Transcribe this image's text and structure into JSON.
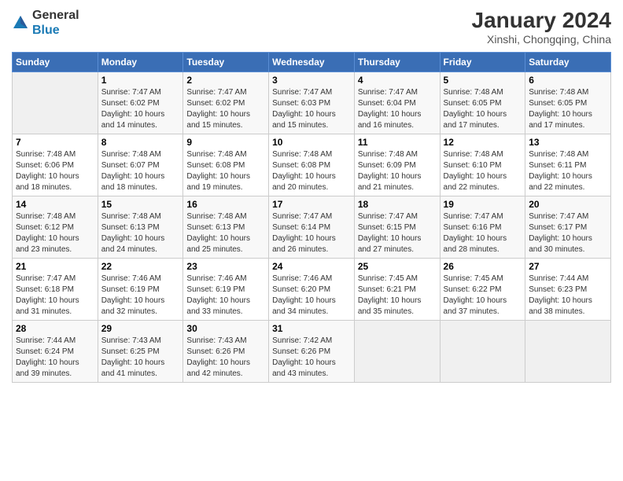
{
  "logo": {
    "general": "General",
    "blue": "Blue"
  },
  "title": "January 2024",
  "subtitle": "Xinshi, Chongqing, China",
  "days_of_week": [
    "Sunday",
    "Monday",
    "Tuesday",
    "Wednesday",
    "Thursday",
    "Friday",
    "Saturday"
  ],
  "weeks": [
    [
      {
        "day": "",
        "info": ""
      },
      {
        "day": "1",
        "info": "Sunrise: 7:47 AM\nSunset: 6:02 PM\nDaylight: 10 hours\nand 14 minutes."
      },
      {
        "day": "2",
        "info": "Sunrise: 7:47 AM\nSunset: 6:02 PM\nDaylight: 10 hours\nand 15 minutes."
      },
      {
        "day": "3",
        "info": "Sunrise: 7:47 AM\nSunset: 6:03 PM\nDaylight: 10 hours\nand 15 minutes."
      },
      {
        "day": "4",
        "info": "Sunrise: 7:47 AM\nSunset: 6:04 PM\nDaylight: 10 hours\nand 16 minutes."
      },
      {
        "day": "5",
        "info": "Sunrise: 7:48 AM\nSunset: 6:05 PM\nDaylight: 10 hours\nand 17 minutes."
      },
      {
        "day": "6",
        "info": "Sunrise: 7:48 AM\nSunset: 6:05 PM\nDaylight: 10 hours\nand 17 minutes."
      }
    ],
    [
      {
        "day": "7",
        "info": "Sunrise: 7:48 AM\nSunset: 6:06 PM\nDaylight: 10 hours\nand 18 minutes."
      },
      {
        "day": "8",
        "info": "Sunrise: 7:48 AM\nSunset: 6:07 PM\nDaylight: 10 hours\nand 18 minutes."
      },
      {
        "day": "9",
        "info": "Sunrise: 7:48 AM\nSunset: 6:08 PM\nDaylight: 10 hours\nand 19 minutes."
      },
      {
        "day": "10",
        "info": "Sunrise: 7:48 AM\nSunset: 6:08 PM\nDaylight: 10 hours\nand 20 minutes."
      },
      {
        "day": "11",
        "info": "Sunrise: 7:48 AM\nSunset: 6:09 PM\nDaylight: 10 hours\nand 21 minutes."
      },
      {
        "day": "12",
        "info": "Sunrise: 7:48 AM\nSunset: 6:10 PM\nDaylight: 10 hours\nand 22 minutes."
      },
      {
        "day": "13",
        "info": "Sunrise: 7:48 AM\nSunset: 6:11 PM\nDaylight: 10 hours\nand 22 minutes."
      }
    ],
    [
      {
        "day": "14",
        "info": "Sunrise: 7:48 AM\nSunset: 6:12 PM\nDaylight: 10 hours\nand 23 minutes."
      },
      {
        "day": "15",
        "info": "Sunrise: 7:48 AM\nSunset: 6:13 PM\nDaylight: 10 hours\nand 24 minutes."
      },
      {
        "day": "16",
        "info": "Sunrise: 7:48 AM\nSunset: 6:13 PM\nDaylight: 10 hours\nand 25 minutes."
      },
      {
        "day": "17",
        "info": "Sunrise: 7:47 AM\nSunset: 6:14 PM\nDaylight: 10 hours\nand 26 minutes."
      },
      {
        "day": "18",
        "info": "Sunrise: 7:47 AM\nSunset: 6:15 PM\nDaylight: 10 hours\nand 27 minutes."
      },
      {
        "day": "19",
        "info": "Sunrise: 7:47 AM\nSunset: 6:16 PM\nDaylight: 10 hours\nand 28 minutes."
      },
      {
        "day": "20",
        "info": "Sunrise: 7:47 AM\nSunset: 6:17 PM\nDaylight: 10 hours\nand 30 minutes."
      }
    ],
    [
      {
        "day": "21",
        "info": "Sunrise: 7:47 AM\nSunset: 6:18 PM\nDaylight: 10 hours\nand 31 minutes."
      },
      {
        "day": "22",
        "info": "Sunrise: 7:46 AM\nSunset: 6:19 PM\nDaylight: 10 hours\nand 32 minutes."
      },
      {
        "day": "23",
        "info": "Sunrise: 7:46 AM\nSunset: 6:19 PM\nDaylight: 10 hours\nand 33 minutes."
      },
      {
        "day": "24",
        "info": "Sunrise: 7:46 AM\nSunset: 6:20 PM\nDaylight: 10 hours\nand 34 minutes."
      },
      {
        "day": "25",
        "info": "Sunrise: 7:45 AM\nSunset: 6:21 PM\nDaylight: 10 hours\nand 35 minutes."
      },
      {
        "day": "26",
        "info": "Sunrise: 7:45 AM\nSunset: 6:22 PM\nDaylight: 10 hours\nand 37 minutes."
      },
      {
        "day": "27",
        "info": "Sunrise: 7:44 AM\nSunset: 6:23 PM\nDaylight: 10 hours\nand 38 minutes."
      }
    ],
    [
      {
        "day": "28",
        "info": "Sunrise: 7:44 AM\nSunset: 6:24 PM\nDaylight: 10 hours\nand 39 minutes."
      },
      {
        "day": "29",
        "info": "Sunrise: 7:43 AM\nSunset: 6:25 PM\nDaylight: 10 hours\nand 41 minutes."
      },
      {
        "day": "30",
        "info": "Sunrise: 7:43 AM\nSunset: 6:26 PM\nDaylight: 10 hours\nand 42 minutes."
      },
      {
        "day": "31",
        "info": "Sunrise: 7:42 AM\nSunset: 6:26 PM\nDaylight: 10 hours\nand 43 minutes."
      },
      {
        "day": "",
        "info": ""
      },
      {
        "day": "",
        "info": ""
      },
      {
        "day": "",
        "info": ""
      }
    ]
  ]
}
